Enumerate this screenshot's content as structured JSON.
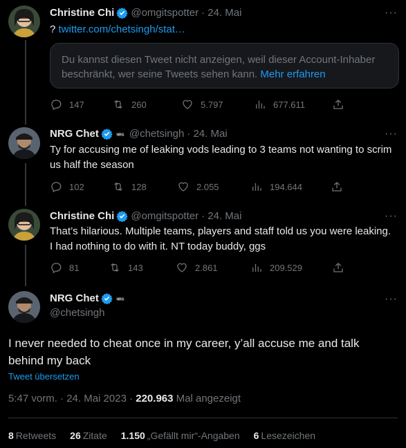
{
  "tweets": [
    {
      "name": "Christine Chi",
      "handle": "@omgitspotter",
      "date": "· 24. Mai",
      "text_prefix": "? ",
      "link": "twitter.com/chetsingh/stat…",
      "notice_text": "Du kannst diesen Tweet nicht anzeigen, weil dieser Account-Inhaber beschränkt, wer seine Tweets sehen kann.",
      "notice_link": "Mehr erfahren",
      "replies": "147",
      "retweets": "260",
      "likes": "5.797",
      "views": "677.611"
    },
    {
      "name": "NRG Chet",
      "affiliation": "NRG",
      "handle": "@chetsingh",
      "date": "· 24. Mai",
      "text": "Ty for accusing me of leaking vods leading to 3 teams not wanting to scrim us half the season",
      "replies": "102",
      "retweets": "128",
      "likes": "2.055",
      "views": "194.644"
    },
    {
      "name": "Christine Chi",
      "handle": "@omgitspotter",
      "date": "· 24. Mai",
      "text": "That’s hilarious. Multiple teams, players and staff told us you were leaking. I had nothing to do with it. NT today buddy, ggs",
      "replies": "81",
      "retweets": "143",
      "likes": "2.861",
      "views": "209.529"
    }
  ],
  "main": {
    "name": "NRG Chet",
    "affiliation": "NRG",
    "handle": "@chetsingh",
    "text": "I never needed to cheat once in my career, y’all accuse me and talk behind my back",
    "translate": "Tweet übersetzen",
    "time": "5:47 vorm. · 24. Mai 2023 · ",
    "views_count": "220.963",
    "views_label": " Mal angezeigt",
    "retweets_count": "8",
    "retweets_label": "Retweets",
    "quotes_count": "26",
    "quotes_label": "Zitate",
    "likes_count": "1.150",
    "likes_label": "„Gefällt mir“-Angaben",
    "bookmarks_count": "6",
    "bookmarks_label": "Lesezeichen"
  },
  "more_icon": "···",
  "colors": {
    "accent": "#1d9bf0",
    "muted": "#71767b",
    "background": "#000000",
    "text": "#e7e9ea"
  }
}
